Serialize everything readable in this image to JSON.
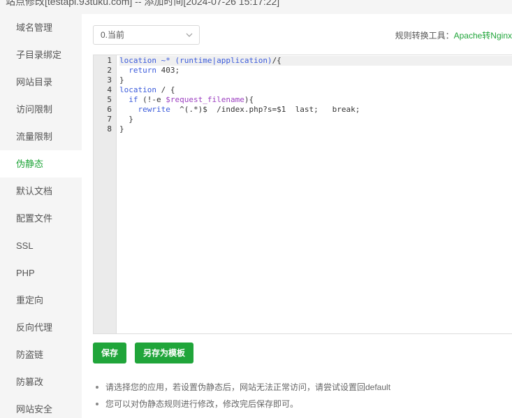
{
  "window": {
    "title": "站点修改[testapi.93tuku.com] -- 添加时间[2024-07-26 15:17:22]"
  },
  "sidebar": {
    "items": [
      {
        "label": "域名管理"
      },
      {
        "label": "子目录绑定"
      },
      {
        "label": "网站目录"
      },
      {
        "label": "访问限制"
      },
      {
        "label": "流量限制"
      },
      {
        "label": "伪静态",
        "active": true
      },
      {
        "label": "默认文档"
      },
      {
        "label": "配置文件"
      },
      {
        "label": "SSL"
      },
      {
        "label": "PHP"
      },
      {
        "label": "重定向"
      },
      {
        "label": "反向代理"
      },
      {
        "label": "防盗链"
      },
      {
        "label": "防篡改"
      },
      {
        "label": "网站安全"
      }
    ]
  },
  "main": {
    "template_select": {
      "value": "0.当前",
      "icon": "chevron-down-icon"
    },
    "converter": {
      "label": "规则转换工具：",
      "link": "Apache转Nginx"
    },
    "editor": {
      "line_numbers": [
        "1",
        "2",
        "3",
        "4",
        "5",
        "6",
        "7",
        "8"
      ],
      "lines": [
        "location ~* (runtime|application)/{",
        "  return 403;",
        "}",
        "location / {",
        "  if (!-e $request_filename){",
        "    rewrite  ^(.*)$  /index.php?s=$1  last;   break;",
        "  }",
        "}"
      ]
    },
    "buttons": {
      "save": "保存",
      "save_as_template": "另存为模板"
    },
    "tips": [
      "请选择您的应用，若设置伪静态后，网站无法正常访问，请尝试设置回default",
      "您可以对伪静态规则进行修改，修改完后保存即可。"
    ]
  },
  "colors": {
    "accent": "#20a53a",
    "sidebar_bg": "#f5f5f5",
    "gutter_bg": "#ebebeb"
  }
}
